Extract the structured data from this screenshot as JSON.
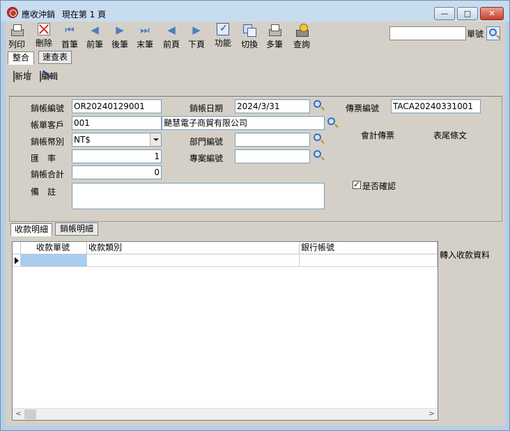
{
  "window": {
    "title": "應收沖銷",
    "subtitle": "現在第 1 頁",
    "min_glyph": "—",
    "max_glyph": "□",
    "close_glyph": "✕"
  },
  "toolbar": {
    "print": "列印",
    "delete": "刪除",
    "first": "首筆",
    "prev": "前筆",
    "next": "後筆",
    "last": "末筆",
    "prev_page": "前頁",
    "next_page": "下頁",
    "function": "功能",
    "switch": "切換",
    "multi": "多筆",
    "query": "查詢",
    "first_glyph": "⏮",
    "prev_glyph": "◀",
    "next_glyph": "▶",
    "last_glyph": "⏭",
    "prev_page_glyph": "◀",
    "next_page_glyph": "▶"
  },
  "search": {
    "value": "",
    "label": "單號"
  },
  "view_tabs": [
    "整合",
    "速查表"
  ],
  "actions": {
    "add": "新增",
    "edit": "編輯"
  },
  "form": {
    "writeoff_no_label": "銷帳編號",
    "writeoff_no": "OR20240129001",
    "writeoff_date_label": "銷帳日期",
    "writeoff_date": "2024/3/31",
    "voucher_no_label": "傳票編號",
    "voucher_no": "TACA20240331001",
    "customer_label": "帳單客戶",
    "customer_code": "001",
    "customer_name": "颶慧電子商貿有限公司",
    "currency_label": "銷帳幣別",
    "currency": "NT$",
    "department_label": "部門編號",
    "department": "",
    "rate_label": "匯　率",
    "rate": "1",
    "project_label": "專案編號",
    "project": "",
    "total_label": "銷帳合計",
    "total": "0",
    "memo_label": "備　註",
    "memo": "",
    "accounting_voucher": "會計傳票",
    "footer_text": "表尾條文",
    "confirmed_label": "是否確認"
  },
  "detail_tabs": [
    "收款明細",
    "銷帳明細"
  ],
  "grid": {
    "columns": [
      "收款單號",
      "收款類別",
      "銀行帳號"
    ],
    "left_arrow": "<",
    "right_arrow": ">"
  },
  "side_action": "轉入收款資料"
}
